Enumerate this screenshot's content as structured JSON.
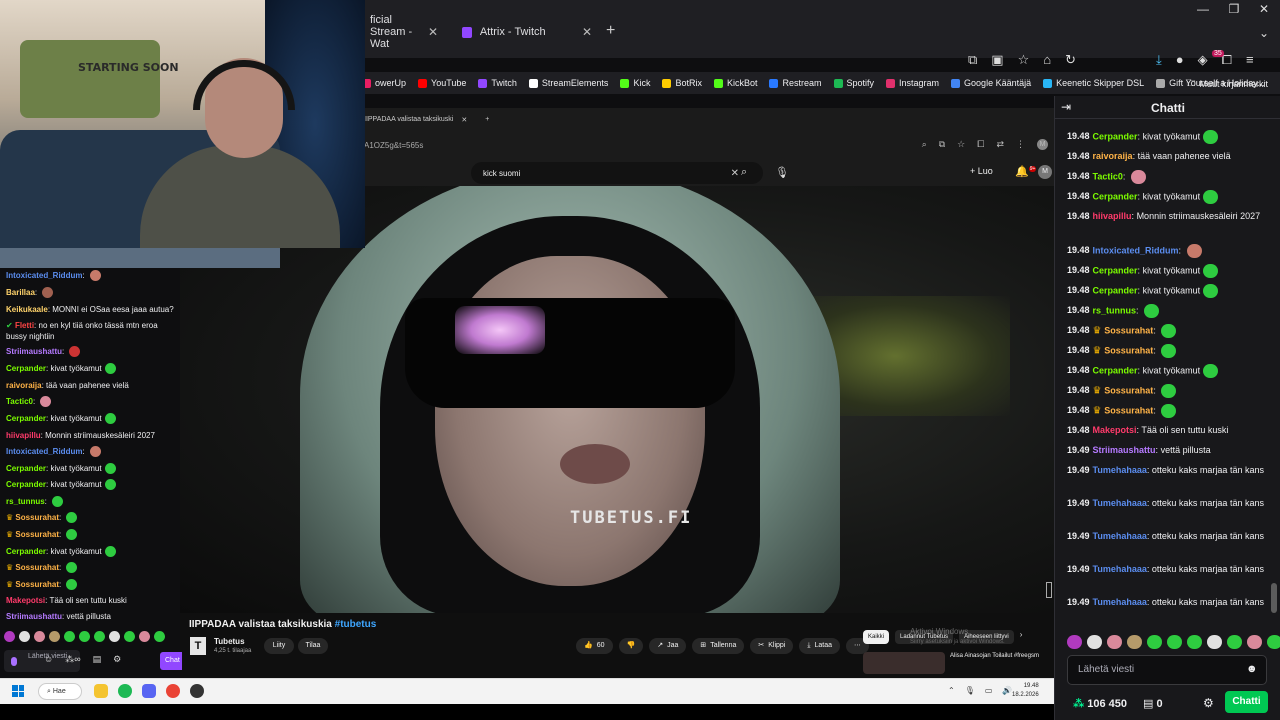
{
  "outer_browser": {
    "tabs": [
      {
        "label": "ficial Stream - Wat",
        "active": false
      },
      {
        "label": "Attrix - Twitch",
        "active": true
      }
    ],
    "new_tab": "+",
    "notif_badge": "35",
    "bookmarks": [
      {
        "label": "owerUp",
        "color": "#e91e63"
      },
      {
        "label": "YouTube",
        "color": "#ff0000"
      },
      {
        "label": "Twitch",
        "color": "#9147ff"
      },
      {
        "label": "StreamElements",
        "color": "#ffffff"
      },
      {
        "label": "Kick",
        "color": "#53fc18"
      },
      {
        "label": "BotRix",
        "color": "#ffcc00"
      },
      {
        "label": "KickBot",
        "color": "#53fc18"
      },
      {
        "label": "Restream",
        "color": "#2979ff"
      },
      {
        "label": "Spotify",
        "color": "#1db954"
      },
      {
        "label": "Instagram",
        "color": "#e1306c"
      },
      {
        "label": "Google Kääntäjä",
        "color": "#4285f4"
      },
      {
        "label": "Keenetic Skipper DSL",
        "color": "#29b6f6"
      },
      {
        "label": "Gift Yourself a Holiday...",
        "color": "#aaaaaa"
      }
    ],
    "other_bookmarks": "Muut kirjanmerkit"
  },
  "inner_browser": {
    "tab_label": "IIPPADAA valistaa taksikuski",
    "url_fragment": "A1OZ5g&t=565s",
    "search_value": "kick suomi",
    "create_label": "Luo",
    "notif_badge": "9+",
    "avatar_letter": "M"
  },
  "video": {
    "watermark": "TUBETUS.FI",
    "title": "IIPPADAA valistaa taksikuskia",
    "hashtag": "#tubetus",
    "channel_name": "Tubetus",
    "channel_subs": "4,25 t. tilaajaa",
    "join_label": "Liity",
    "subscribe_label": "Tilaa",
    "like_count": "60",
    "share_label": "Jaa",
    "save_label": "Tallenna",
    "clip_label": "Klippi",
    "download_label": "Lataa",
    "chips": [
      "Kaikki",
      "Ladannut Tubetus",
      "Aiheeseen liittyvi"
    ],
    "recommended_title": "Alisa Ainasojan Toilailut #freegsm",
    "activate_windows": "Aktivoi Windows",
    "activate_windows_sub": "Siirry asetuksiin ja aktivoi Windows."
  },
  "webcam": {
    "poster_text": "STARTING SOON"
  },
  "left_chat": {
    "messages": [
      {
        "user": "Intoxicated_Riddum",
        "color": "#5b8def",
        "text": "",
        "emote": "#c77a6a"
      },
      {
        "user": "Barillaa",
        "color": "#ffd36b",
        "text": "",
        "emote": "#a06050"
      },
      {
        "user": "Keikukaale",
        "color": "#ffd36b",
        "text": "MONNI ei OSaa eesa jaaa autua?"
      },
      {
        "user": "Fletti",
        "color": "#ff4545",
        "text": "no en kyl tiiä onko tässä mtn eroa bussy nightiin",
        "prefix": "check"
      },
      {
        "user": "Striimaushattu",
        "color": "#b57aff",
        "text": "",
        "emote": "#c33"
      },
      {
        "user": "Cerpander",
        "color": "#7cfc00",
        "text": "kivat työkamut",
        "emote": "#2ecc40"
      },
      {
        "user": "raivoraija",
        "color": "#ffb347",
        "text": "tää vaan pahenee vielä"
      },
      {
        "user": "Tactic0",
        "color": "#7cfc00",
        "text": "",
        "emote": "#d9899b"
      },
      {
        "user": "Cerpander",
        "color": "#7cfc00",
        "text": "kivat työkamut",
        "emote": "#2ecc40"
      },
      {
        "user": "hiivapillu",
        "color": "#ff3b6b",
        "text": "Monnin striimauskesäleiri 2027"
      },
      {
        "user": "Intoxicated_Riddum",
        "color": "#5b8def",
        "text": "",
        "emote": "#c77a6a"
      },
      {
        "user": "Cerpander",
        "color": "#7cfc00",
        "text": "kivat työkamut",
        "emote": "#2ecc40"
      },
      {
        "user": "Cerpander",
        "color": "#7cfc00",
        "text": "kivat työkamut",
        "emote": "#2ecc40"
      },
      {
        "user": "rs_tunnus",
        "color": "#7cfc00",
        "text": "",
        "emote": "#2ecc40"
      },
      {
        "user": "Sossurahat",
        "color": "#ffb347",
        "text": "",
        "emote": "#2ecc40",
        "prefix": "crown"
      },
      {
        "user": "Sossurahat",
        "color": "#ffb347",
        "text": "",
        "emote": "#2ecc40",
        "prefix": "crown"
      },
      {
        "user": "Cerpander",
        "color": "#7cfc00",
        "text": "kivat työkamut",
        "emote": "#2ecc40"
      },
      {
        "user": "Sossurahat",
        "color": "#ffb347",
        "text": "",
        "emote": "#2ecc40",
        "prefix": "crown"
      },
      {
        "user": "Sossurahat",
        "color": "#ffb347",
        "text": "",
        "emote": "#2ecc40",
        "prefix": "crown"
      },
      {
        "user": "Makepotsi",
        "color": "#ff3b6b",
        "text": "Tää oli sen tuttu kuski"
      },
      {
        "user": "Striimaushattu",
        "color": "#b57aff",
        "text": "vettä pillusta"
      }
    ],
    "input_placeholder": "Lähetä viesti",
    "chat_button": "Chat"
  },
  "right_chat": {
    "title": "Chatti",
    "messages": [
      {
        "ts": "19.48",
        "user": "Cerpander",
        "color": "#7cfc00",
        "text": "kivat työkamut",
        "emote": "#2ecc40"
      },
      {
        "ts": "19.48",
        "user": "raivoraija",
        "color": "#ffb347",
        "text": "tää vaan pahenee vielä"
      },
      {
        "ts": "19.48",
        "user": "Tactic0",
        "color": "#7cfc00",
        "text": "",
        "emote": "#d9899b"
      },
      {
        "ts": "19.48",
        "user": "Cerpander",
        "color": "#7cfc00",
        "text": "kivat työkamut",
        "emote": "#2ecc40"
      },
      {
        "ts": "19.48",
        "user": "hiivapillu",
        "color": "#ff3b6b",
        "text": "Monnin striimauskesäleiri 2027"
      },
      {
        "ts": "19.48",
        "user": "Intoxicated_Riddum",
        "color": "#5b8def",
        "text": "",
        "emote": "#c77a6a"
      },
      {
        "ts": "19.48",
        "user": "Cerpander",
        "color": "#7cfc00",
        "text": "kivat työkamut",
        "emote": "#2ecc40"
      },
      {
        "ts": "19.48",
        "user": "Cerpander",
        "color": "#7cfc00",
        "text": "kivat työkamut",
        "emote": "#2ecc40"
      },
      {
        "ts": "19.48",
        "user": "rs_tunnus",
        "color": "#7cfc00",
        "text": "",
        "emote": "#2ecc40"
      },
      {
        "ts": "19.48",
        "user": "Sossurahat",
        "color": "#ffb347",
        "text": "",
        "emote": "#2ecc40",
        "prefix": "crown"
      },
      {
        "ts": "19.48",
        "user": "Sossurahat",
        "color": "#ffb347",
        "text": "",
        "emote": "#2ecc40",
        "prefix": "crown"
      },
      {
        "ts": "19.48",
        "user": "Cerpander",
        "color": "#7cfc00",
        "text": "kivat työkamut",
        "emote": "#2ecc40"
      },
      {
        "ts": "19.48",
        "user": "Sossurahat",
        "color": "#ffb347",
        "text": "",
        "emote": "#2ecc40",
        "prefix": "crown"
      },
      {
        "ts": "19.48",
        "user": "Sossurahat",
        "color": "#ffb347",
        "text": "",
        "emote": "#2ecc40",
        "prefix": "crown"
      },
      {
        "ts": "19.48",
        "user": "Makepotsi",
        "color": "#ff3b6b",
        "text": "Tää oli sen tuttu kuski"
      },
      {
        "ts": "19.49",
        "user": "Striimaushattu",
        "color": "#b57aff",
        "text": "vettä pillusta"
      },
      {
        "ts": "19.49",
        "user": "Tumehahaaa",
        "color": "#5b8def",
        "text": "otteku kaks marjaa tän kans"
      },
      {
        "ts": "19.49",
        "user": "Tumehahaaa",
        "color": "#5b8def",
        "text": "otteku kaks marjaa tän kans"
      },
      {
        "ts": "19.49",
        "user": "Tumehahaaa",
        "color": "#5b8def",
        "text": "otteku kaks marjaa tän kans"
      },
      {
        "ts": "19.49",
        "user": "Tumehahaaa",
        "color": "#5b8def",
        "text": "otteku kaks marjaa tän kans"
      },
      {
        "ts": "19.49",
        "user": "Tumehahaaa",
        "color": "#5b8def",
        "text": "otteku kaks marjaa tän kans"
      }
    ],
    "input_placeholder": "Lähetä viesti",
    "points": "106 450",
    "predictions": "0",
    "chat_button": "Chatti"
  },
  "taskbar": {
    "search_label": "Hae",
    "time": "19.48",
    "date": "18.2.2026"
  },
  "emote_colors": [
    "#b03abf",
    "#e0e0e0",
    "#d9899b",
    "#b59a6a",
    "#2ecc40",
    "#2ecc40",
    "#2ecc40",
    "#e0e0e0",
    "#2ecc40",
    "#d9899b",
    "#2ecc40"
  ]
}
